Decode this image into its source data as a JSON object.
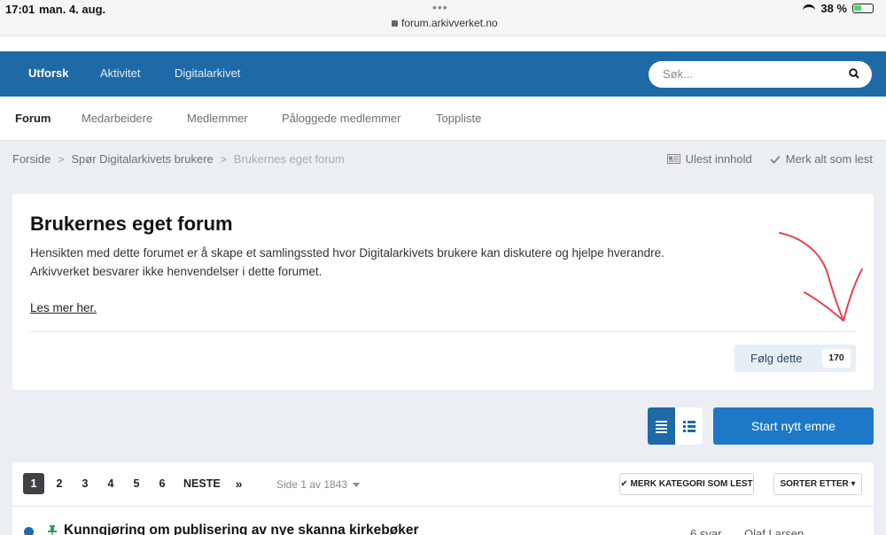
{
  "statusbar": {
    "time": "17:01",
    "date": "man. 4. aug.",
    "dots": "•••",
    "url": "forum.arkivverket.no",
    "battery": "38 %"
  },
  "primary_nav": {
    "items": [
      "Utforsk",
      "Aktivitet",
      "Digitalarkivet"
    ],
    "search_placeholder": "Søk..."
  },
  "secondary_nav": {
    "items": [
      "Forum",
      "Medarbeidere",
      "Medlemmer",
      "Påloggede medlemmer",
      "Toppliste"
    ]
  },
  "breadcrumb": {
    "items": [
      "Forside",
      "Spør Digitalarkivets brukere",
      "Brukernes eget forum"
    ],
    "separator": ">"
  },
  "breadcrumb_actions": {
    "unread": "Ulest innhold",
    "mark_all": "Merk alt som lest"
  },
  "forum_header": {
    "title": "Brukernes eget forum",
    "description_line1": "Hensikten med dette forumet er å skape et samlingssted hvor Digitalarkivets brukere kan diskutere og hjelpe hverandre.",
    "description_line2": "Arkivverket besvarer ikke henvendelser i dette forumet.",
    "read_more": "Les mer her.",
    "follow_label": "Følg dette",
    "follow_count": "170"
  },
  "actions": {
    "start_topic": "Start nytt emne"
  },
  "pagination": {
    "pages": [
      "1",
      "2",
      "3",
      "4",
      "5",
      "6"
    ],
    "active": "1",
    "next": "NESTE",
    "last": "»",
    "page_info": "Side 1 av 1843"
  },
  "list_tools": {
    "mark_read": "✔ MERK KATEGORI SOM LEST",
    "sort": "SORTER ETTER ▾"
  },
  "topics": [
    {
      "title": "Kunngjøring om publisering av nye skanna kirkebøker",
      "replies": "6 svar",
      "author": "Olaf Larsen"
    }
  ],
  "colors": {
    "brand_blue": "#1e6aa6",
    "button_blue": "#1e78c8",
    "annotation_red": "#e8434f"
  }
}
